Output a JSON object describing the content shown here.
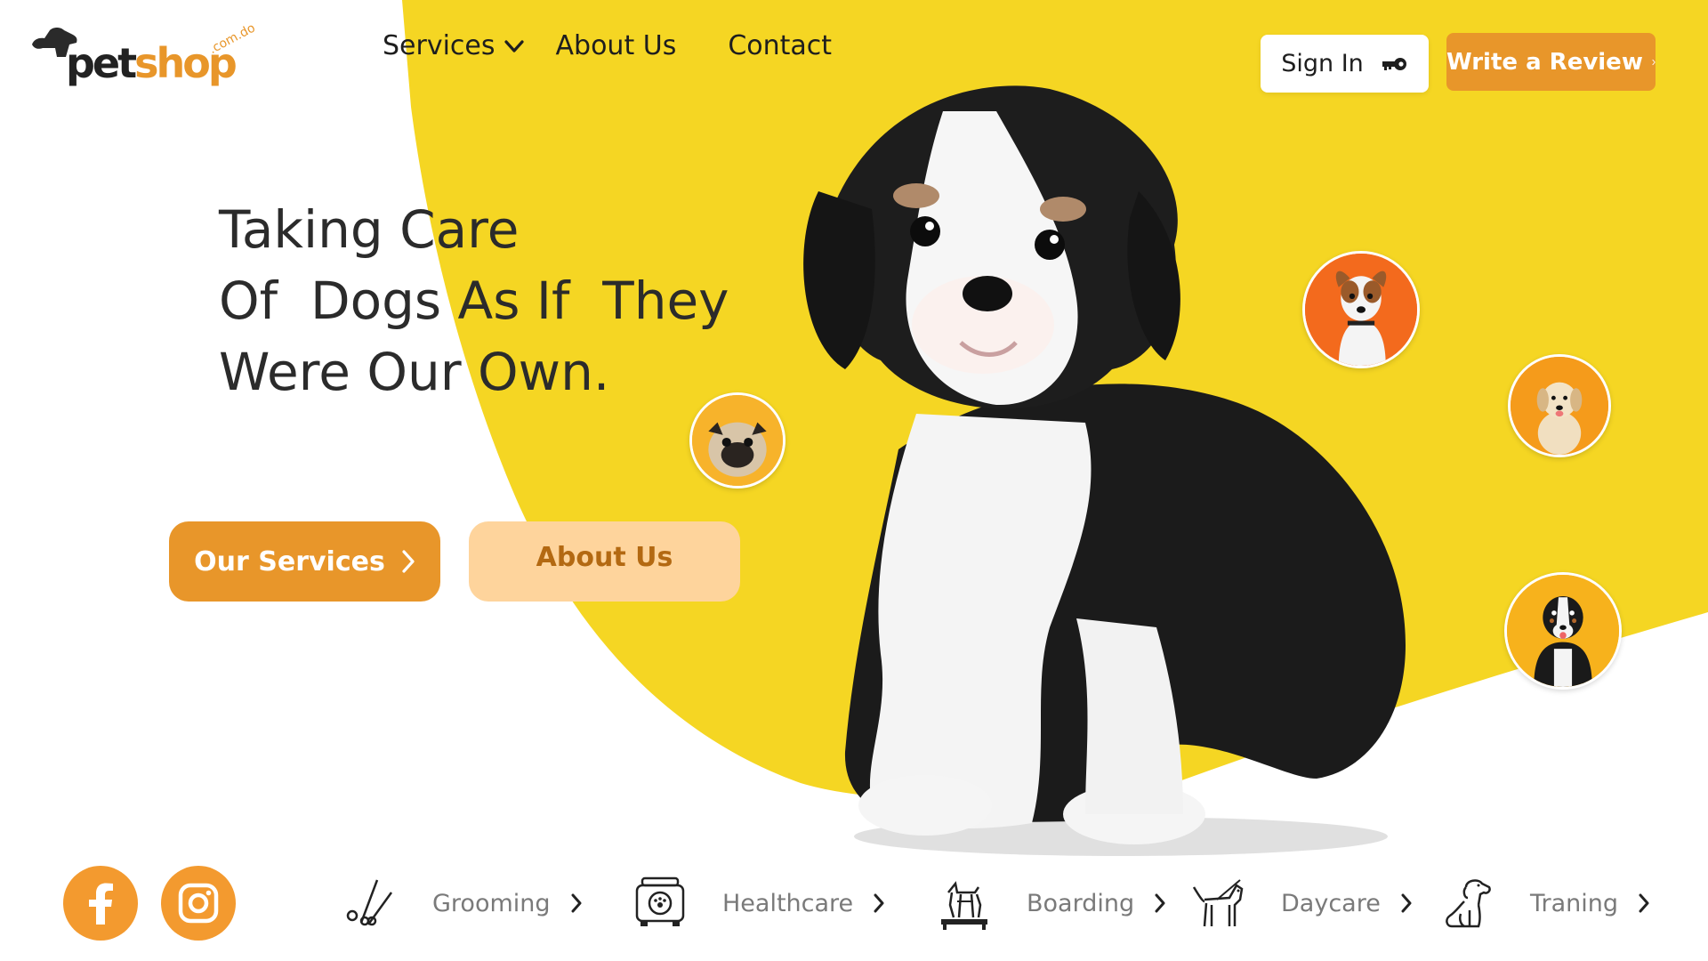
{
  "brand": {
    "name_part1": "pet",
    "name_part2": "shop",
    "tld": ".com.do",
    "logo_icon": "dog-head-icon",
    "accent": "#e8962a",
    "yellow": "#f5d623"
  },
  "nav": {
    "services_label": "Services",
    "about_label": "About Us",
    "contact_label": "Contact",
    "services_icon": "chevron-down-icon"
  },
  "header": {
    "signin_label": "Sign In",
    "signin_icon": "key-icon",
    "review_label": "Write a Review",
    "review_icon": "chevron-right-icon"
  },
  "hero": {
    "line1": "Taking Care",
    "line2": "Of  Dogs As If  They",
    "line3": "Were Our Own.",
    "primary_button": "Our Services",
    "secondary_button": "About Us"
  },
  "social": {
    "facebook_icon": "facebook-icon",
    "instagram_icon": "instagram-icon"
  },
  "services": [
    {
      "label": "Grooming",
      "icon": "scissors-icon"
    },
    {
      "label": "Healthcare",
      "icon": "pet-carrier-icon"
    },
    {
      "label": "Boarding",
      "icon": "dog-bed-icon"
    },
    {
      "label": "Daycare",
      "icon": "dog-icon"
    },
    {
      "label": "Traning",
      "icon": "sitting-dog-icon"
    }
  ]
}
